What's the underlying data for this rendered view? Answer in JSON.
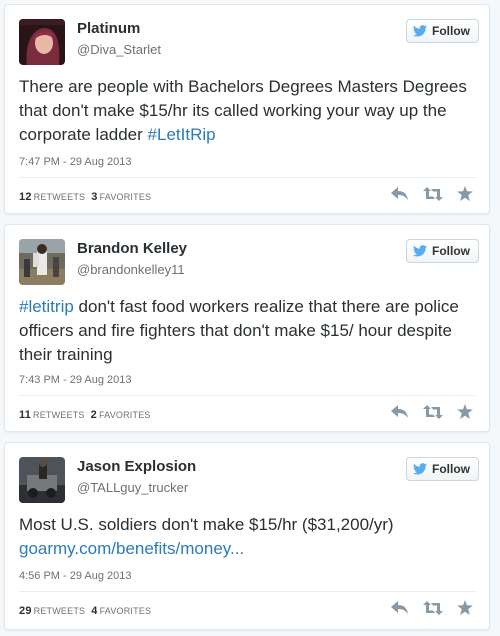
{
  "follow_label": "Follow",
  "stat_labels": {
    "retweets": "RETWEETS",
    "favorites": "FAVORITES"
  },
  "colors": {
    "link": "#2b7bb9",
    "twitter_blue": "#55acee",
    "action_gray": "#8899a6"
  },
  "icons": {
    "follow": "twitter-bird-icon",
    "reply": "reply-icon",
    "retweet": "retweet-icon",
    "favorite": "star-icon"
  },
  "tweets": [
    {
      "name": "Platinum",
      "handle": "@Diva_Starlet",
      "text": "There are people with Bachelors Degrees Masters Degrees that don't make $15/hr its called working your way up the corporate ladder ",
      "link": "#LetItRip",
      "time": "7:47 PM - 29 Aug 2013",
      "retweets": "12",
      "favorites": "3"
    },
    {
      "name": "Brandon Kelley",
      "handle": "@brandonkelley11",
      "link": "#letitrip",
      "text": " don't fast food workers realize that there are police officers and fire fighters that don't make $15/ hour despite their training",
      "time": "7:43 PM - 29 Aug 2013",
      "retweets": "11",
      "favorites": "2"
    },
    {
      "name": "Jason Explosion",
      "handle": "@TALLguy_trucker",
      "text": "Most U.S. soldiers don't make $15/hr ($31,200/yr) ",
      "link": "goarmy.com/benefits/money...",
      "time": "4:56 PM - 29 Aug 2013",
      "retweets": "29",
      "favorites": "4"
    }
  ]
}
